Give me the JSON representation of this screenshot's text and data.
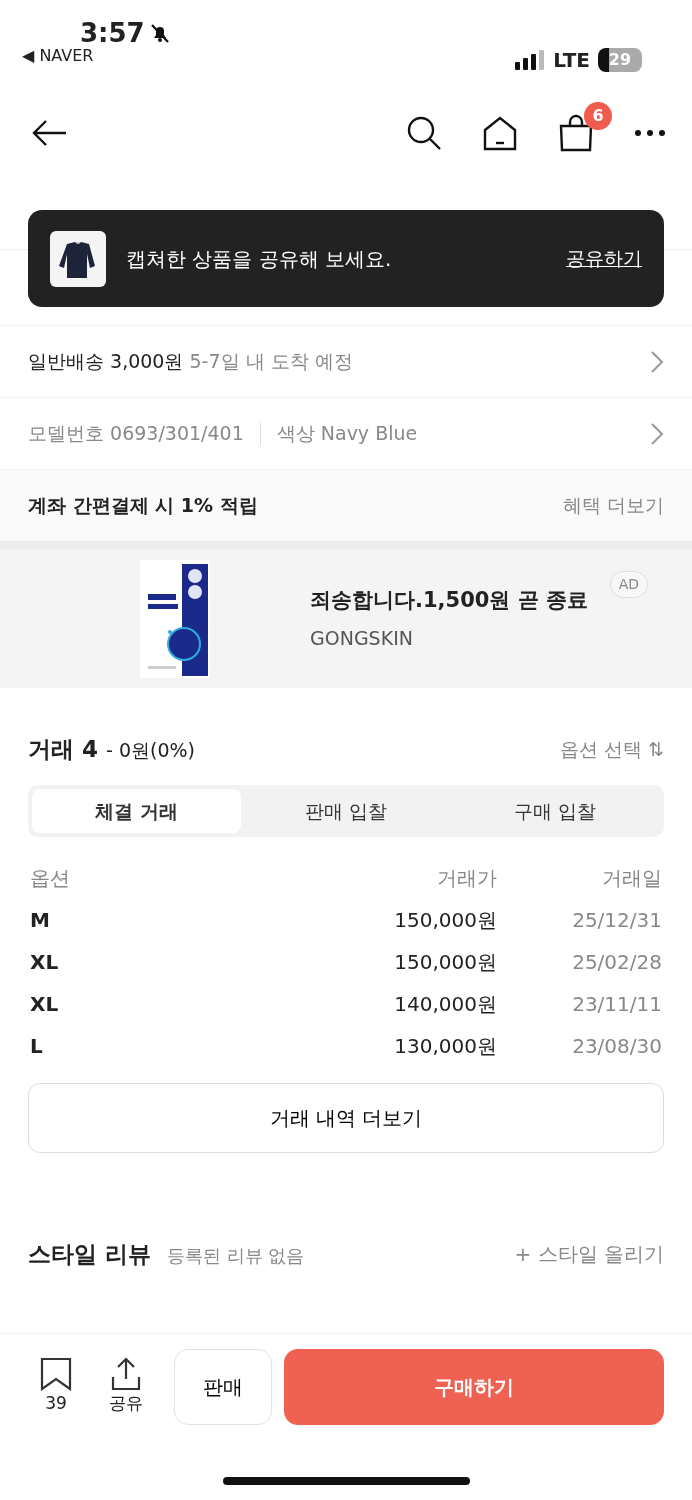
{
  "status_bar": {
    "time": "3:57",
    "back_app": "◀ NAVER",
    "network": "LTE",
    "battery": "29"
  },
  "nav": {
    "cart_count": "6"
  },
  "toast": {
    "message": "캡쳐한 상품을 공유해 보세요.",
    "action": "공유하기"
  },
  "shipping": {
    "label": "일반배송 3,000원",
    "note": "5-7일 내 도착 예정"
  },
  "model": {
    "label": "모델번호 0693/301/401",
    "color_option": "색상 Navy Blue"
  },
  "benefit": {
    "label": "계좌 간편결제 시 1% 적립",
    "link": "혜택 더보기"
  },
  "ad": {
    "kind": "picture",
    "title": "죄송합니다.1,500원 곧 종료",
    "brand": "GONGSKIN",
    "badge": "AD"
  },
  "trades": {
    "title": "거래 4",
    "change": "- 0원(0%)",
    "option_select": "옵션 선택 ⇅",
    "segments": [
      {
        "label": "체결 거래",
        "selected": true
      },
      {
        "label": "판매 입찰",
        "selected": false
      },
      {
        "label": "구매 입찰",
        "selected": false
      }
    ],
    "columns": [
      "옵션",
      "거래가",
      "거래일"
    ],
    "rows": [
      [
        "M",
        "150,000원",
        "25/12/31"
      ],
      [
        "XL",
        "150,000원",
        "25/02/28"
      ],
      [
        "XL",
        "140,000원",
        "23/11/11"
      ],
      [
        "L",
        "130,000원",
        "23/08/30"
      ]
    ],
    "more": "거래 내역 더보기"
  },
  "style_review": {
    "title": "스타일 리뷰",
    "note": "등록된 리뷰 없음",
    "action": "+ 스타일 올리기"
  },
  "bottom_bar": {
    "bookmark_count": "39",
    "share": "공유",
    "sell": "판매",
    "buy": "구매하기"
  }
}
